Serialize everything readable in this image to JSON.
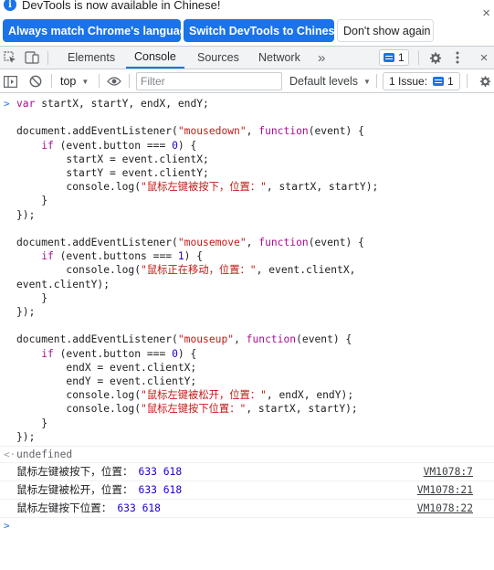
{
  "banner": {
    "message": "DevTools is now available in Chinese!",
    "close_glyph": "×",
    "buttons": {
      "match_language": "Always match Chrome's language",
      "switch_chinese": "Switch DevTools to Chinese",
      "dont_show": "Don't show again"
    }
  },
  "tabs": {
    "items": [
      "Elements",
      "Console",
      "Sources",
      "Network"
    ],
    "active": "Console",
    "more": "»",
    "message_count": "1"
  },
  "console_toolbar": {
    "context": "top",
    "filter_placeholder": "Filter",
    "levels": "Default levels",
    "issues_label": "1 Issue:",
    "issues_count": "1"
  },
  "console": {
    "input_prompt": ">",
    "result_prompt": "<·",
    "result": "undefined",
    "logs": [
      {
        "label": "鼠标左键被按下，位置：",
        "values": "633 618",
        "source": "VM1078:7"
      },
      {
        "label": "鼠标左键被松开，位置：",
        "values": "633 618",
        "source": "VM1078:21"
      },
      {
        "label": "鼠标左键按下位置：",
        "values": "633 618",
        "source": "VM1078:22"
      }
    ],
    "empty_prompt": ">"
  },
  "colors": {
    "accent": "#1a73e8",
    "keyword": "#aa0d91",
    "string": "#c41a16",
    "number": "#1c00cf"
  },
  "icons": [
    "info-icon",
    "close-icon",
    "inspect-icon",
    "device-toolbar-icon",
    "message-icon",
    "settings-icon",
    "kebab-menu-icon",
    "sidebar-toggle-icon",
    "clear-console-icon",
    "eye-icon",
    "issue-icon"
  ]
}
